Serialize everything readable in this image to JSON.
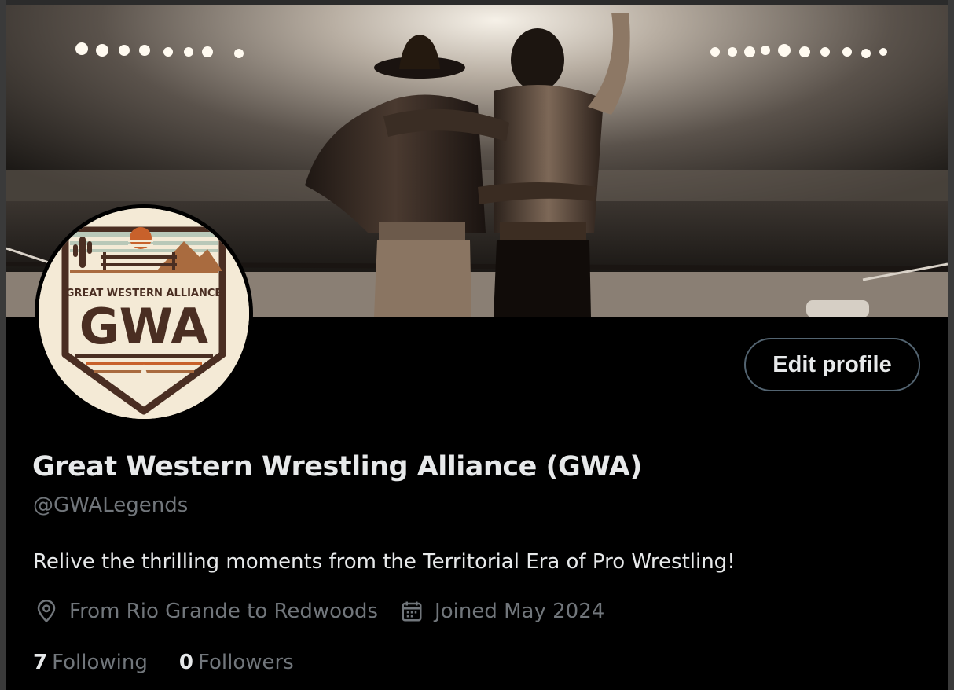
{
  "profile": {
    "display_name": "Great Western Wrestling Alliance (GWA)",
    "handle": "@GWALegends",
    "bio": "Relive the thrilling moments from the Territorial Era of Pro Wrestling!",
    "location": "From Rio Grande to Redwoods",
    "joined": "Joined May 2024",
    "edit_button_label": "Edit profile"
  },
  "stats": {
    "following_count": "7",
    "following_label": "Following",
    "followers_count": "0",
    "followers_label": "Followers"
  },
  "avatar_logo": {
    "top_text": "GREAT WESTERN ALLIANCE",
    "main_text": "GWA"
  },
  "icons": {
    "location": "location-pin-icon",
    "calendar": "calendar-icon"
  },
  "colors": {
    "background": "#000000",
    "primary_text": "#e7e9ea",
    "secondary_text": "#71767b",
    "button_border": "#536471",
    "logo_cream": "#f4ead6",
    "logo_brown": "#4a2e22",
    "logo_orange": "#c8612b"
  }
}
